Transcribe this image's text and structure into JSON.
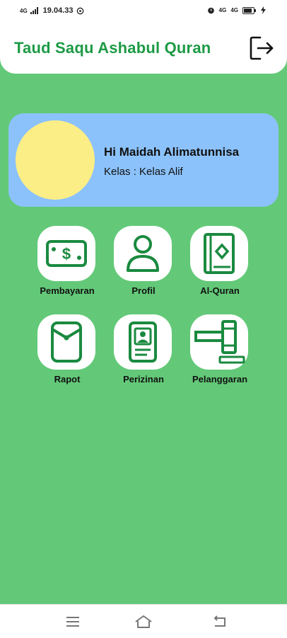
{
  "status_bar": {
    "network_badge": "4G",
    "time": "19.04.33",
    "right_badge_1": "4G",
    "right_badge_2": "4G"
  },
  "header": {
    "title": "Taud Saqu Ashabul Quran",
    "title_color": "#1d9a45"
  },
  "profile": {
    "greeting": "Hi Maidah Alimatunnisa",
    "class_label": "Kelas : Kelas Alif"
  },
  "menu": {
    "items": [
      {
        "label": "Pembayaran",
        "icon": "money-icon"
      },
      {
        "label": "Profil",
        "icon": "user-icon"
      },
      {
        "label": "Al-Quran",
        "icon": "book-icon"
      },
      {
        "label": "Rapot",
        "icon": "envelope-icon"
      },
      {
        "label": "Perizinan",
        "icon": "id-card-icon"
      },
      {
        "label": "Pelanggaran",
        "icon": "gavel-icon"
      }
    ]
  },
  "nav": {
    "menu_icon": "menu-icon",
    "home_icon": "home-icon",
    "back_icon": "back-icon"
  },
  "colors": {
    "background": "#63c978",
    "card": "#8cc2fb",
    "avatar": "#fcee86",
    "accent": "#1a8a3f"
  }
}
